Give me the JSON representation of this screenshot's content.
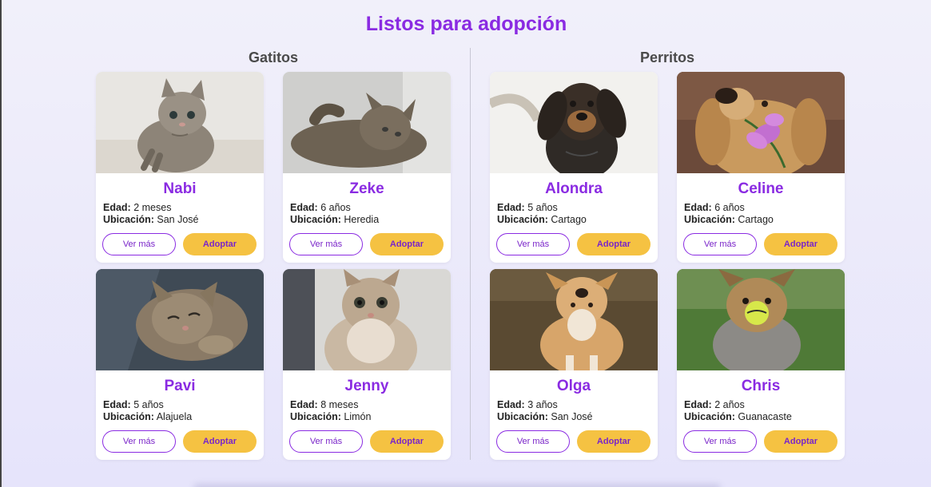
{
  "page": {
    "title": "Listos para adopción"
  },
  "sections": {
    "cats": {
      "title": "Gatitos"
    },
    "dogs": {
      "title": "Perritos"
    }
  },
  "labels": {
    "age": "Edad:",
    "location": "Ubicación:",
    "more": "Ver más",
    "adopt": "Adoptar"
  },
  "pets": [
    {
      "name": "Nabi",
      "age": "2 meses",
      "location": "San José",
      "photo": "kitten-photo"
    },
    {
      "name": "Zeke",
      "age": "6 años",
      "location": "Heredia",
      "photo": "cat-photo"
    },
    {
      "name": "Alondra",
      "age": "5 años",
      "location": "Cartago",
      "photo": "dog-photo"
    },
    {
      "name": "Celine",
      "age": "6 años",
      "location": "Cartago",
      "photo": "dog-photo"
    },
    {
      "name": "Pavi",
      "age": "5 años",
      "location": "Alajuela",
      "photo": "kitten-photo"
    },
    {
      "name": "Jenny",
      "age": "8 meses",
      "location": "Limón",
      "photo": "cat-photo"
    },
    {
      "name": "Olga",
      "age": "3 años",
      "location": "San José",
      "photo": "dog-photo"
    },
    {
      "name": "Chris",
      "age": "2 años",
      "location": "Guanacaste",
      "photo": "dog-photo"
    }
  ]
}
